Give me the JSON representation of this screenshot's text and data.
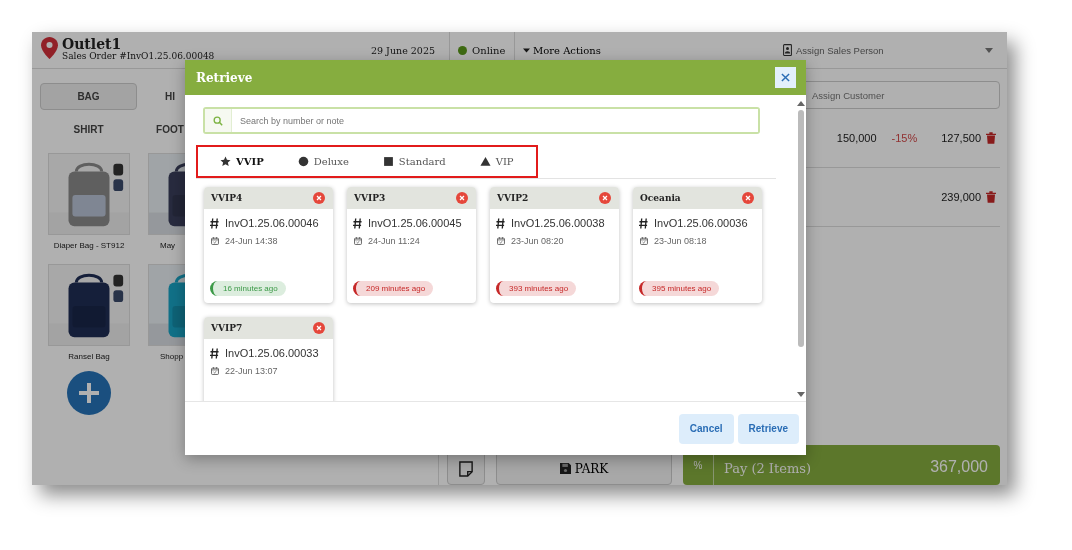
{
  "app": {
    "outlet": "Outlet1",
    "order": "Sales Order #InvO1.25.06.00048",
    "date": "29 June 2025",
    "status": "Online",
    "more_actions": "More Actions",
    "sales_person": "Assign Sales Person"
  },
  "categories": [
    {
      "label": "BAG",
      "selected": true
    },
    {
      "label": "HI",
      "selected": false
    },
    {
      "label": "SHIRT",
      "selected": false
    },
    {
      "label": "FOOT",
      "selected": false
    }
  ],
  "products": [
    {
      "name": "Diaper Bag - ST912"
    },
    {
      "name": "May"
    },
    {
      "name": "Ransel Bag"
    },
    {
      "name": "Shopp"
    }
  ],
  "customer": {
    "placeholder": "Assign Customer"
  },
  "cart": [
    {
      "price": "150,000",
      "discount": "-15%",
      "total": "127,500"
    },
    {
      "total": "239,000"
    }
  ],
  "footer": {
    "percent": "%",
    "park": "PARK",
    "pay": "Pay (2 Items)",
    "amount": "367,000"
  },
  "dialog": {
    "title": "Retrieve",
    "search": {
      "placeholder": "Search by number or note"
    },
    "tabs": [
      {
        "label": "VVIP",
        "kind": "star",
        "selected": true
      },
      {
        "label": "Deluxe",
        "kind": "circle",
        "selected": false
      },
      {
        "label": "Standard",
        "kind": "square",
        "selected": false
      },
      {
        "label": "VIP",
        "kind": "triangle",
        "selected": false
      }
    ],
    "orders": [
      {
        "name": "VVIP4",
        "number": "InvO1.25.06.00046",
        "date": "24-Jun 14:38",
        "age": "16 minutes ago",
        "color": "#3c9a48"
      },
      {
        "name": "VVIP3",
        "number": "InvO1.25.06.00045",
        "date": "24-Jun 11:24",
        "age": "209 minutes ago",
        "color": "#c62828"
      },
      {
        "name": "VVIP2",
        "number": "InvO1.25.06.00038",
        "date": "23-Jun 08:20",
        "age": "393 minutes ago",
        "color": "#c62828"
      },
      {
        "name": "Oceania",
        "number": "InvO1.25.06.00036",
        "date": "23-Jun 08:18",
        "age": "395 minutes ago",
        "color": "#c62828"
      },
      {
        "name": "VVIP7",
        "number": "InvO1.25.06.00033",
        "date": "22-Jun 13:07"
      }
    ],
    "buttons": [
      "Cancel",
      "Retrieve"
    ]
  }
}
